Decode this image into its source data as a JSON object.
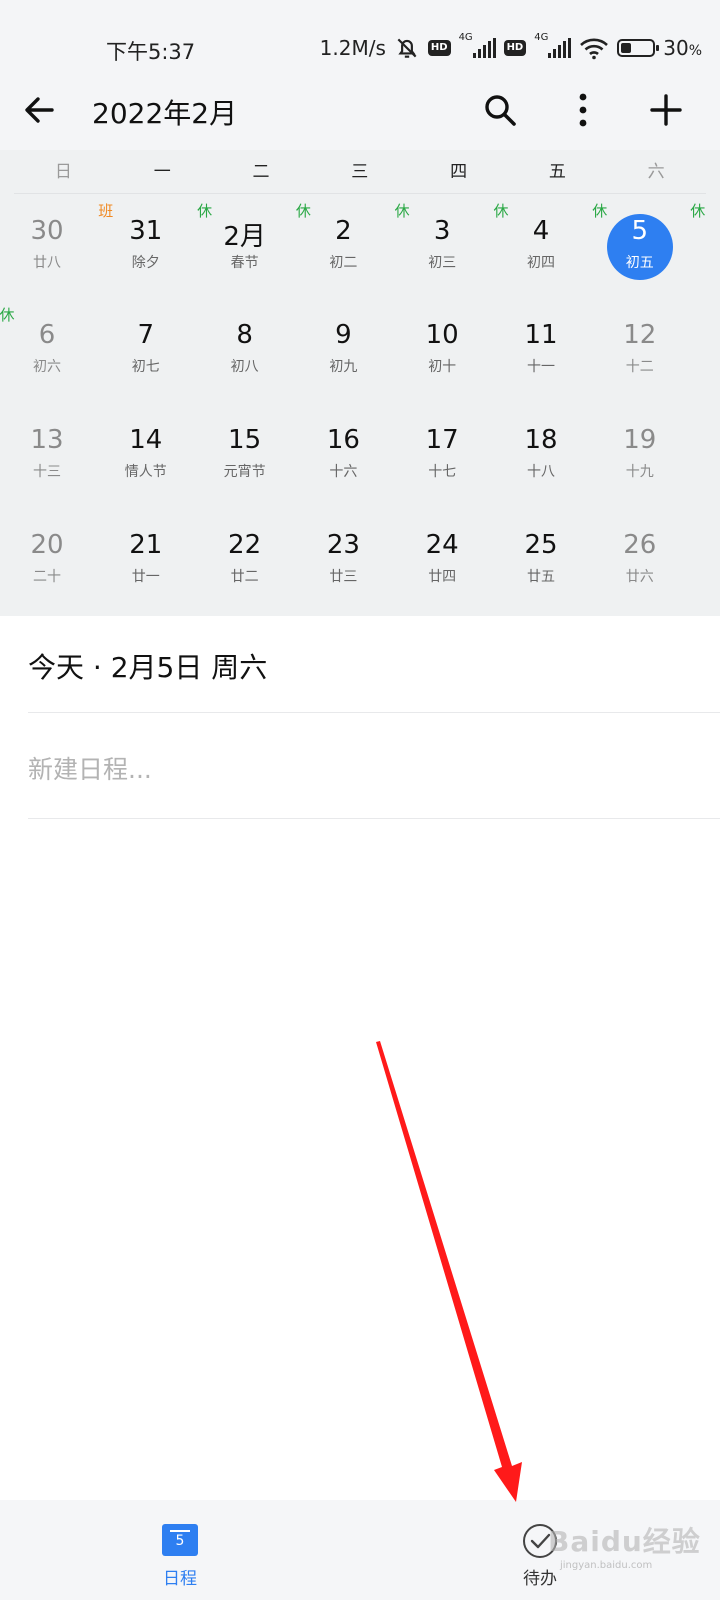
{
  "status_bar": {
    "time": "下午5:37",
    "net_speed": "1.2M/s",
    "hd1": "HD",
    "hd2": "HD",
    "sig1_label": "4G",
    "sig2_label": "4G",
    "battery_level": 0.3,
    "battery_pct": "30",
    "battery_unit": "%"
  },
  "header": {
    "title": "2022年2月",
    "icons": [
      "back-arrow-icon",
      "search-icon",
      "more-vertical-icon",
      "plus-icon"
    ]
  },
  "calendar": {
    "weekdays": [
      "日",
      "一",
      "二",
      "三",
      "四",
      "五",
      "六"
    ],
    "weeks": [
      [
        {
          "num": "30",
          "lunar": "廿八",
          "dim": true
        },
        {
          "num": "31",
          "lunar": "除夕",
          "badge": "班",
          "badge_type": "work"
        },
        {
          "num": "2月",
          "lunar": "春节",
          "badge": "休",
          "badge_type": "rest"
        },
        {
          "num": "2",
          "lunar": "初二",
          "badge": "休",
          "badge_type": "rest"
        },
        {
          "num": "3",
          "lunar": "初三",
          "badge": "休",
          "badge_type": "rest"
        },
        {
          "num": "4",
          "lunar": "初四",
          "badge": "休",
          "badge_type": "rest"
        },
        {
          "num": "5",
          "lunar": "初五",
          "badge": "休",
          "badge_type": "rest",
          "today": true,
          "extra_badge": "休"
        }
      ],
      [
        {
          "num": "6",
          "lunar": "初六",
          "dim": true,
          "badge": "休",
          "badge_type": "rest"
        },
        {
          "num": "7",
          "lunar": "初七"
        },
        {
          "num": "8",
          "lunar": "初八"
        },
        {
          "num": "9",
          "lunar": "初九"
        },
        {
          "num": "10",
          "lunar": "初十"
        },
        {
          "num": "11",
          "lunar": "十一"
        },
        {
          "num": "12",
          "lunar": "十二",
          "dim": true
        }
      ],
      [
        {
          "num": "13",
          "lunar": "十三",
          "dim": true
        },
        {
          "num": "14",
          "lunar": "情人节"
        },
        {
          "num": "15",
          "lunar": "元宵节"
        },
        {
          "num": "16",
          "lunar": "十六"
        },
        {
          "num": "17",
          "lunar": "十七"
        },
        {
          "num": "18",
          "lunar": "十八"
        },
        {
          "num": "19",
          "lunar": "十九",
          "dim": true
        }
      ],
      [
        {
          "num": "20",
          "lunar": "二十",
          "dim": true
        },
        {
          "num": "21",
          "lunar": "廿一"
        },
        {
          "num": "22",
          "lunar": "廿二"
        },
        {
          "num": "23",
          "lunar": "廿三"
        },
        {
          "num": "24",
          "lunar": "廿四"
        },
        {
          "num": "25",
          "lunar": "廿五"
        },
        {
          "num": "26",
          "lunar": "廿六",
          "dim": true
        }
      ]
    ]
  },
  "agenda": {
    "date_label": "今天  · 2月5日 周六",
    "new_event_placeholder": "新建日程..."
  },
  "bottom_nav": {
    "items": [
      {
        "label": "日程",
        "icon_text": "5",
        "active": true
      },
      {
        "label": "待办",
        "active": false
      }
    ],
    "active_color": "#2e7ff1"
  },
  "overlay": {
    "arrow_color": "#ff1a1a",
    "watermark": "Baidu经验",
    "watermark_sub": "jingyan.baidu.com"
  }
}
